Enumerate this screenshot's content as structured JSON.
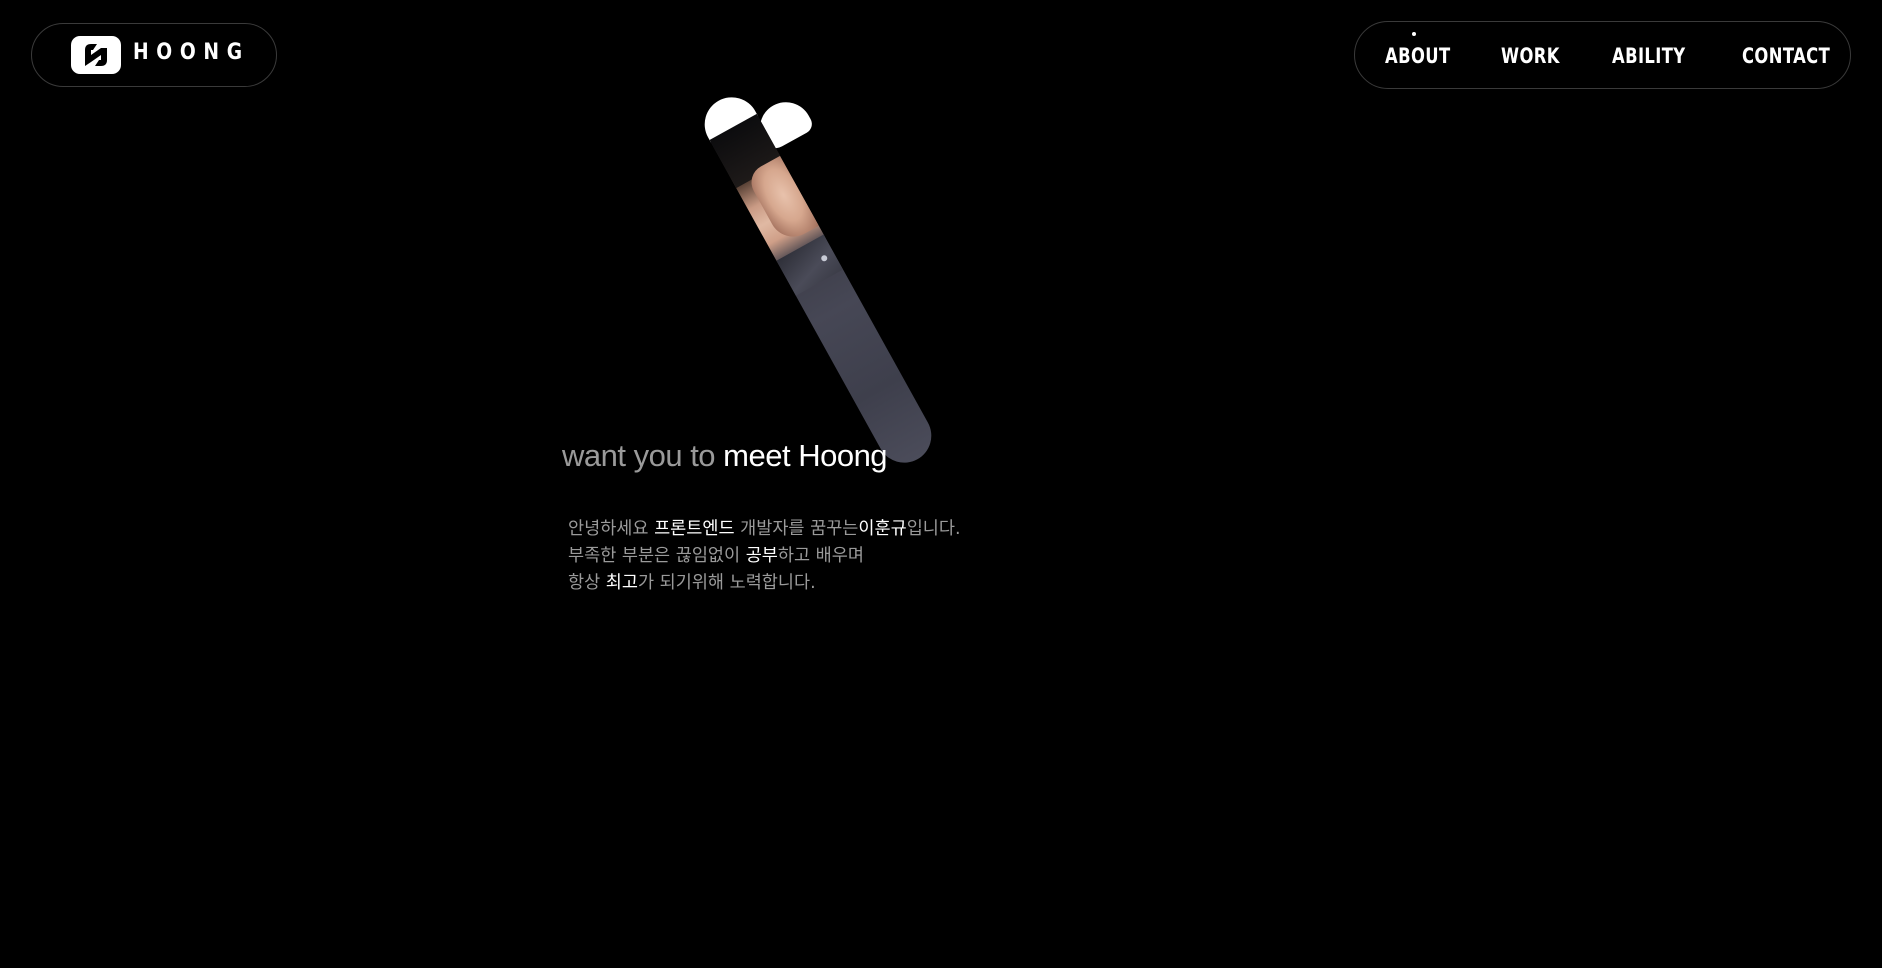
{
  "brand": {
    "logo_text": "HOONG",
    "logo_icon": "hoong-h-logo-icon"
  },
  "nav": {
    "items": [
      {
        "label": "ABOUT",
        "active": true
      },
      {
        "label": "WORK",
        "active": false
      },
      {
        "label": "ABILITY",
        "active": false
      },
      {
        "label": "CONTACT",
        "active": false
      }
    ]
  },
  "hero": {
    "headline_dim": "want you to",
    "headline_bright": "meet Hoong",
    "photo_alt": "portrait-photo"
  },
  "intro": {
    "line1": {
      "a": "안녕하세요 ",
      "b": "프론트엔드",
      "c": " 개발자를 꿈꾸는",
      "d": "이훈규",
      "e": "입니다."
    },
    "line2": {
      "a": "부족한 부분은 끊임없이 ",
      "b": "공부",
      "c": "하고 배우며"
    },
    "line3": {
      "a": "항상 ",
      "b": "최고",
      "c": "가 되기위해 노력합니다."
    }
  },
  "colors": {
    "background": "#000000",
    "text_primary": "#ffffff",
    "text_muted": "#9a9a9a",
    "border": "#3a3a3a"
  }
}
